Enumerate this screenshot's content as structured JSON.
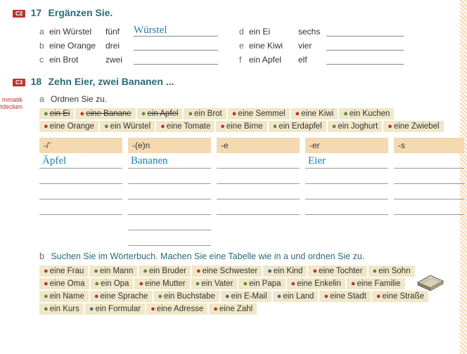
{
  "ex17": {
    "badge": "C2",
    "num": "17",
    "title": "Ergänzen Sie.",
    "rows": [
      {
        "l": "a",
        "w": "ein Würstel",
        "q": "fünf",
        "a": "Würstel",
        "l2": "d",
        "w2": "ein Ei",
        "q2": "sechs",
        "a2": ""
      },
      {
        "l": "b",
        "w": "eine Orange",
        "q": "drei",
        "a": "",
        "l2": "e",
        "w2": "eine Kiwi",
        "q2": "vier",
        "a2": ""
      },
      {
        "l": "c",
        "w": "ein Brot",
        "q": "zwei",
        "a": "",
        "l2": "f",
        "w2": "ein Apfel",
        "q2": "elf",
        "a2": ""
      }
    ]
  },
  "ex18": {
    "badge": "C3",
    "num": "18",
    "title": "Zehn Eier, zwei Bananen ...",
    "side1": "mmatik",
    "side2": "tdecken",
    "a_label": "a",
    "a_instr": "Ordnen Sie zu.",
    "words_a": [
      {
        "t": "ein Ei",
        "c": "d-green",
        "s": true
      },
      {
        "t": "eine Banane",
        "c": "d-red",
        "s": true
      },
      {
        "t": "ein Apfel",
        "c": "d-green",
        "s": true
      },
      {
        "t": "ein Brot",
        "c": "d-green",
        "s": false
      },
      {
        "t": "eine Semmel",
        "c": "d-red",
        "s": false
      },
      {
        "t": "eine Kiwi",
        "c": "d-red",
        "s": false
      },
      {
        "t": "ein Kuchen",
        "c": "d-green",
        "s": false
      },
      {
        "t": "eine Orange",
        "c": "d-red",
        "s": false
      },
      {
        "t": "ein Würstel",
        "c": "d-green",
        "s": false
      },
      {
        "t": "eine Tomate",
        "c": "d-red",
        "s": false
      },
      {
        "t": "eine Birne",
        "c": "d-red",
        "s": false
      },
      {
        "t": "ein Erdapfel",
        "c": "d-green",
        "s": false
      },
      {
        "t": "ein Joghurt",
        "c": "d-green",
        "s": false
      },
      {
        "t": "eine Zwiebel",
        "c": "d-red",
        "s": false
      }
    ],
    "headers": [
      "-/¨",
      "-(e)n",
      "-e",
      "-er",
      "-s"
    ],
    "col1": "Äpfel",
    "col2": "Bananen",
    "col4": "Eier",
    "b_label": "b",
    "b_instr": "Suchen Sie im Wörterbuch. Machen Sie eine Tabelle wie in a und ordnen Sie zu.",
    "words_b": [
      {
        "t": "eine Frau",
        "c": "d-red"
      },
      {
        "t": "ein Mann",
        "c": "d-green"
      },
      {
        "t": "ein Bruder",
        "c": "d-green"
      },
      {
        "t": "eine Schwester",
        "c": "d-red"
      },
      {
        "t": "ein Kind",
        "c": "d-blue"
      },
      {
        "t": "eine Tochter",
        "c": "d-red"
      },
      {
        "t": "ein Sohn",
        "c": "d-green"
      },
      {
        "t": "eine Oma",
        "c": "d-red"
      },
      {
        "t": "ein Opa",
        "c": "d-green"
      },
      {
        "t": "eine Mutter",
        "c": "d-red"
      },
      {
        "t": "ein Vater",
        "c": "d-green"
      },
      {
        "t": "ein Papa",
        "c": "d-green"
      },
      {
        "t": "eine Enkelin",
        "c": "d-red"
      },
      {
        "t": "eine Familie",
        "c": "d-red"
      },
      {
        "t": "ein Name",
        "c": "d-green"
      },
      {
        "t": "eine Sprache",
        "c": "d-red"
      },
      {
        "t": "ein Buchstabe",
        "c": "d-green"
      },
      {
        "t": "ein E-Mail",
        "c": "d-blue"
      },
      {
        "t": "ein Land",
        "c": "d-blue"
      },
      {
        "t": "eine Stadt",
        "c": "d-red"
      },
      {
        "t": "eine Straße",
        "c": "d-red"
      },
      {
        "t": "ein Kurs",
        "c": "d-green"
      },
      {
        "t": "ein Formular",
        "c": "d-blue"
      },
      {
        "t": "eine Adresse",
        "c": "d-red"
      },
      {
        "t": "eine Zahl",
        "c": "d-red"
      }
    ]
  }
}
